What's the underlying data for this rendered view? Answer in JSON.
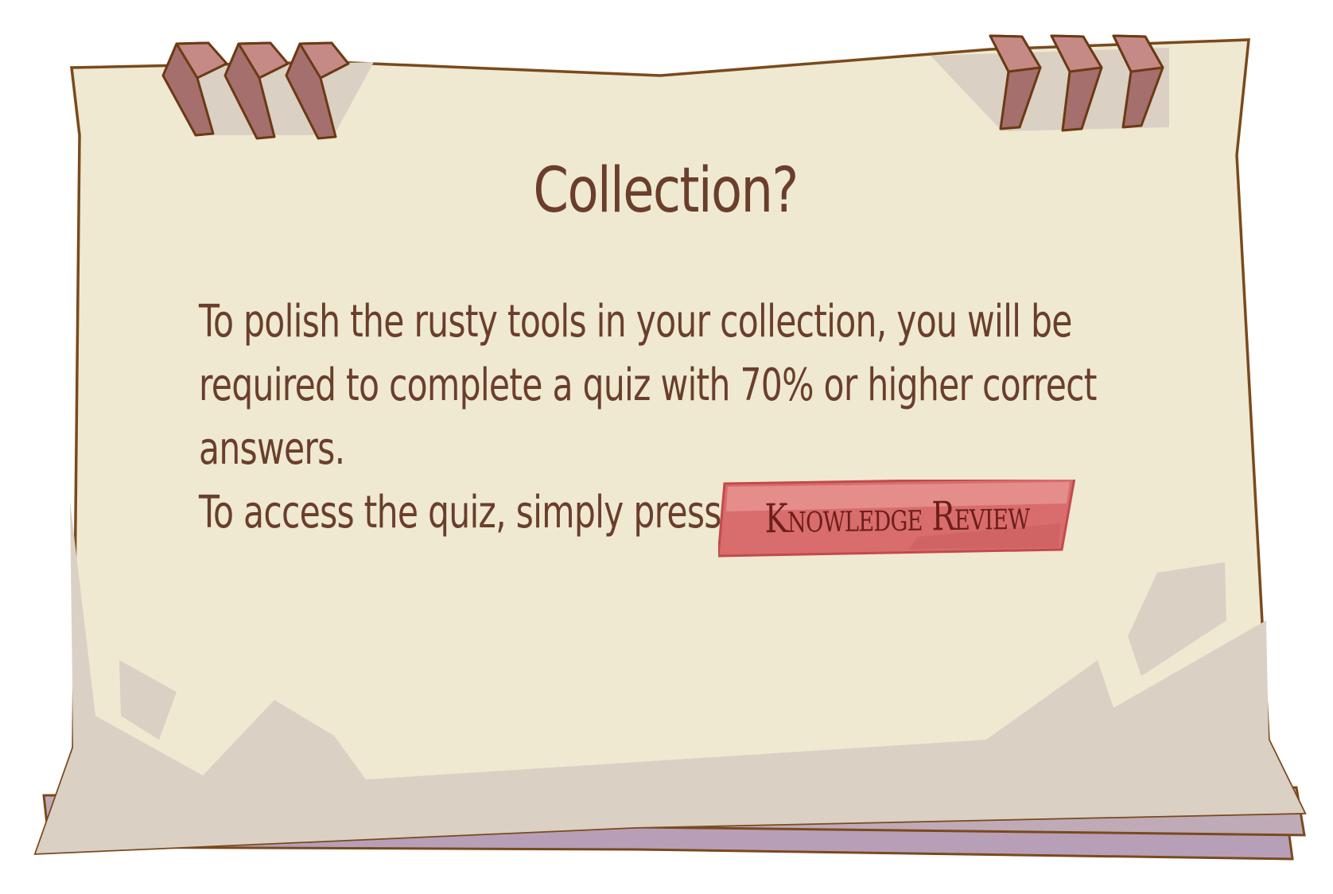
{
  "dialog": {
    "title": "Collection?",
    "body_lines": [
      "To polish the rusty tools in your collection, you will be",
      "required to complete a quiz with 70% or higher correct",
      "answers."
    ],
    "access_line": "To access the quiz, simply press",
    "button_label": "Knowledge Review"
  },
  "colors": {
    "paper": "#efe9d2",
    "paper_shadow": "#dad0c4",
    "outline": "#7a4a1c",
    "tab": "#a46f6c",
    "button": "#d96c6c",
    "text": "#6b3e2c"
  }
}
